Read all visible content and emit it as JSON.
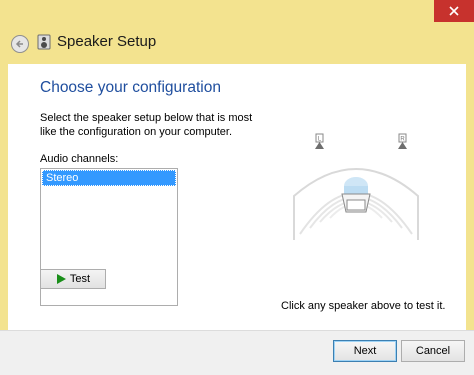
{
  "window": {
    "title": "Speaker Setup",
    "close_icon": "close-icon",
    "back_icon": "back-arrow-icon",
    "app_icon": "speaker-icon"
  },
  "content": {
    "heading": "Choose your configuration",
    "description": "Select the speaker setup below that is most like the configuration on your computer.",
    "channels_label": "Audio channels:",
    "channels": [
      "Stereo"
    ],
    "selected_channel": "Stereo",
    "test_button": "Test",
    "hint": "Click any speaker above to test it."
  },
  "diagram": {
    "left_label": "L",
    "right_label": "R"
  },
  "footer": {
    "next_label": "Next",
    "cancel_label": "Cancel"
  },
  "colors": {
    "frame": "#f3e38f",
    "heading": "#1f4e9e",
    "selection": "#3399ff",
    "close": "#c7322d"
  }
}
